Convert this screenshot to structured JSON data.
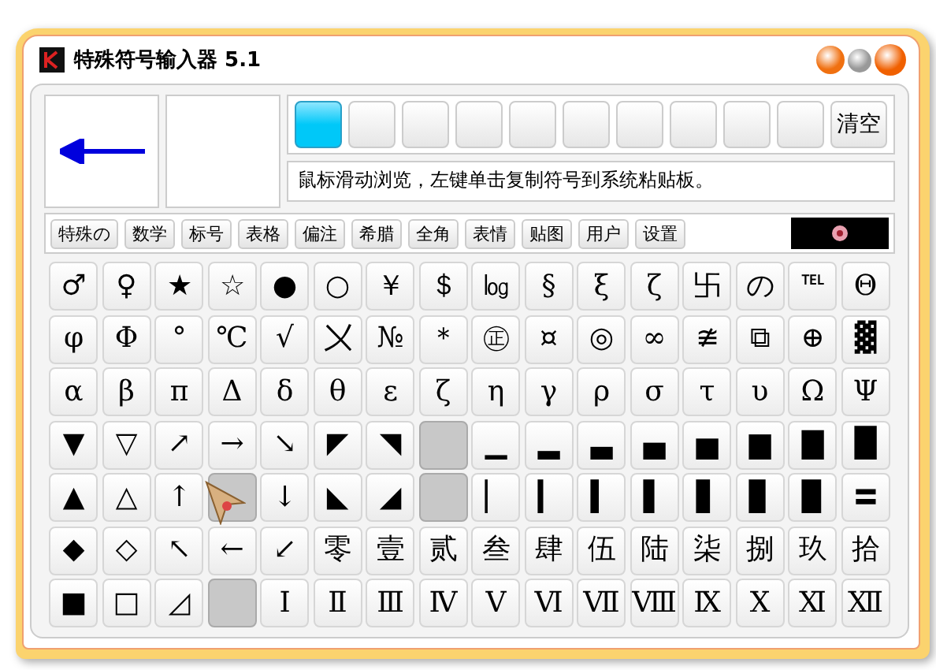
{
  "window": {
    "title": "特殊符号输入器 5.1"
  },
  "slots": [
    {
      "selected": true
    },
    {
      "selected": false
    },
    {
      "selected": false
    },
    {
      "selected": false
    },
    {
      "selected": false
    },
    {
      "selected": false
    },
    {
      "selected": false
    },
    {
      "selected": false
    },
    {
      "selected": false
    },
    {
      "selected": false
    }
  ],
  "clear_button": "清空",
  "hint": "鼠标滑动浏览，左键单击复制符号到系统粘贴板。",
  "tabs": [
    {
      "label": "特殊の"
    },
    {
      "label": "数学"
    },
    {
      "label": "标号"
    },
    {
      "label": "表格"
    },
    {
      "label": "偏注"
    },
    {
      "label": "希腊"
    },
    {
      "label": "全角"
    },
    {
      "label": "表情"
    },
    {
      "label": "贴图"
    },
    {
      "label": "用户"
    },
    {
      "label": "设置"
    }
  ],
  "symbol_rows": [
    [
      "♂",
      "♀",
      "★",
      "☆",
      "●",
      "○",
      "￥",
      "＄",
      "㏒",
      "§",
      "ξ",
      "ζ",
      "卐",
      "の",
      "℡",
      "Θ"
    ],
    [
      "φ",
      "Φ",
      "°",
      "℃",
      "√",
      "〤",
      "№",
      "＊",
      "㊣",
      "¤",
      "◎",
      "∞",
      "≇",
      "⧉",
      "⊕",
      "▓"
    ],
    [
      "α",
      "β",
      "π",
      "Δ",
      "δ",
      "θ",
      "ε",
      "ζ",
      "η",
      "γ",
      "ρ",
      "σ",
      "τ",
      "υ",
      "Ω",
      "Ψ"
    ],
    [
      "▼",
      "▽",
      "↗",
      "→",
      "↘",
      "◤",
      "◥",
      "",
      "▁",
      "▂",
      "▃",
      "▄",
      "▅",
      "▆",
      "▇",
      "█"
    ],
    [
      "▲",
      "△",
      "↑",
      "",
      "↓",
      "◣",
      "◢",
      "",
      "▏",
      "▎",
      "▍",
      "▌",
      "▋",
      "▊",
      "▉",
      "〓"
    ],
    [
      "◆",
      "◇",
      "↖",
      "←",
      "↙",
      "零",
      "壹",
      "贰",
      "叁",
      "肆",
      "伍",
      "陆",
      "柒",
      "捌",
      "玖",
      "拾"
    ],
    [
      "■",
      "□",
      "◿",
      "",
      "Ⅰ",
      "Ⅱ",
      "Ⅲ",
      "Ⅳ",
      "Ⅴ",
      "Ⅵ",
      "Ⅶ",
      "Ⅷ",
      "Ⅸ",
      "Ⅹ",
      "Ⅺ",
      "Ⅻ"
    ]
  ]
}
